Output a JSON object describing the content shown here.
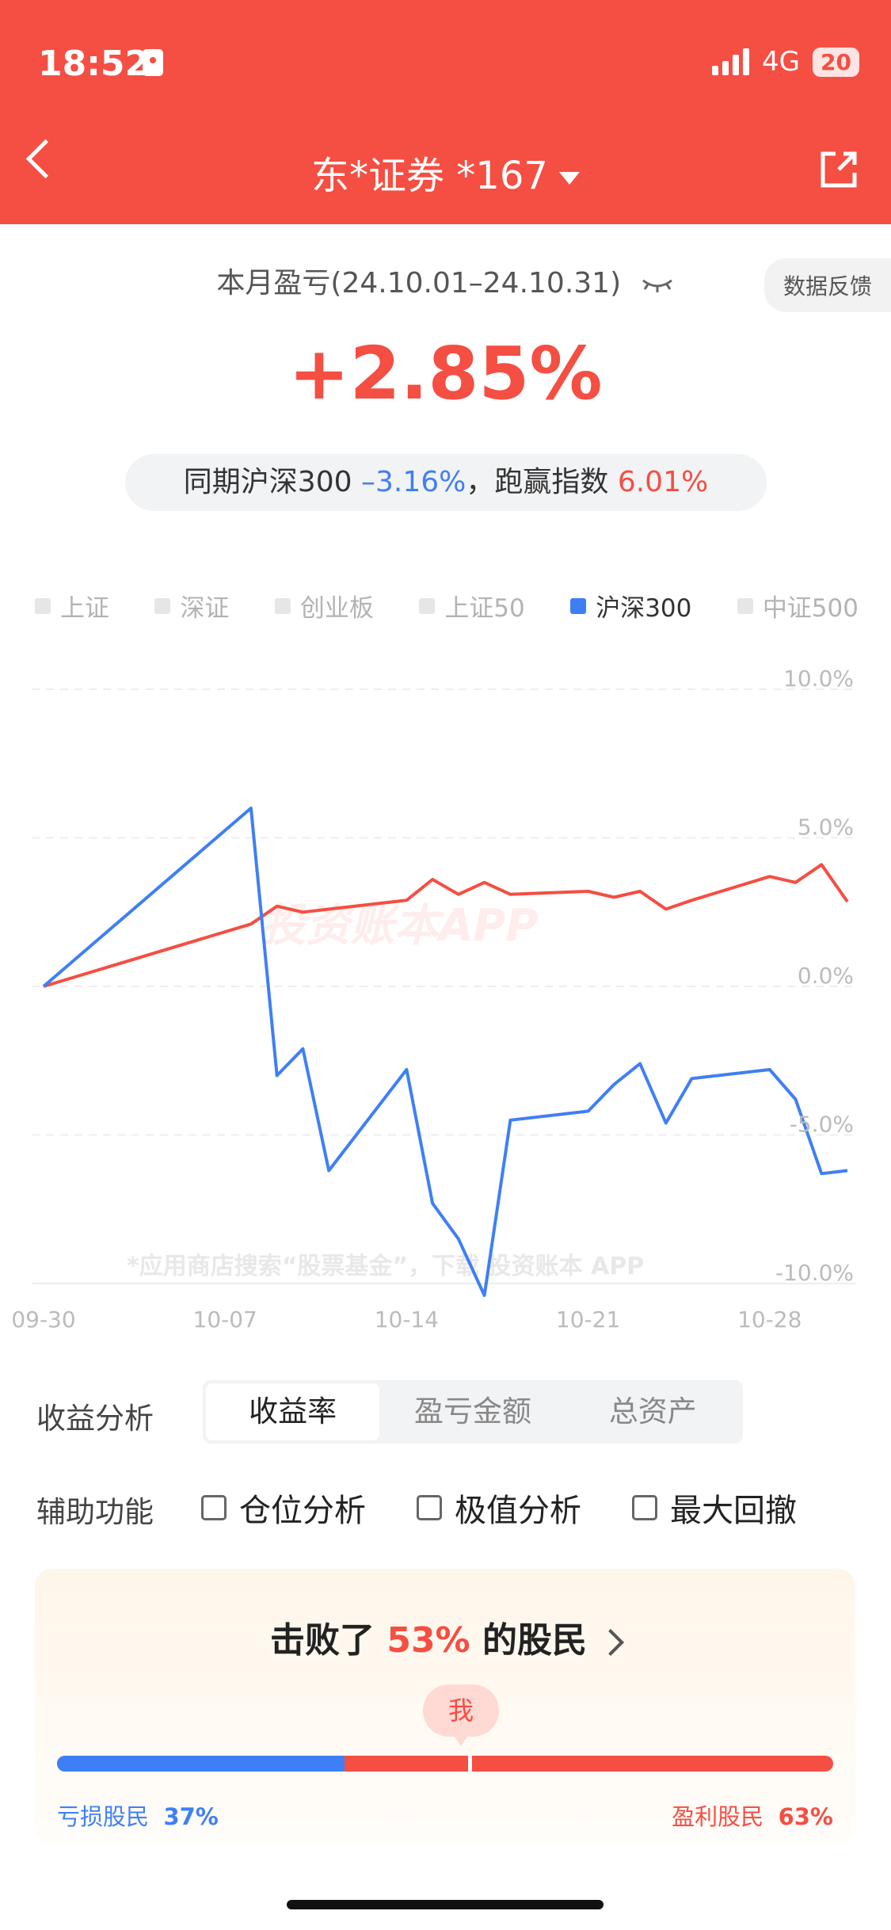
{
  "status": {
    "time": "18:52",
    "network": "4G",
    "battery": "20"
  },
  "header": {
    "title": "东*证券 *167"
  },
  "summary": {
    "period": "本月盈亏(24.10.01–24.10.31)",
    "feedback": "数据反馈",
    "return": "+2.85%",
    "compare_prefix": "同期沪深300",
    "index_return": "–3.16%",
    "compare_mid": "，跑赢指数",
    "outperform": "6.01%"
  },
  "legend": [
    {
      "label": "上证",
      "active": false
    },
    {
      "label": "深证",
      "active": false
    },
    {
      "label": "创业板",
      "active": false
    },
    {
      "label": "上证50",
      "active": false
    },
    {
      "label": "沪深300",
      "active": true
    },
    {
      "label": "中证500",
      "active": false
    }
  ],
  "colors": {
    "account": "#f54e42",
    "index": "#3f7ff5",
    "brand": "#f54e42"
  },
  "chart_data": {
    "type": "line",
    "x": [
      "09-30",
      "10-08",
      "10-09",
      "10-10",
      "10-11",
      "10-14",
      "10-15",
      "10-16",
      "10-17",
      "10-18",
      "10-21",
      "10-22",
      "10-23",
      "10-24",
      "10-25",
      "10-28",
      "10-29",
      "10-30",
      "10-31"
    ],
    "xticks": [
      "09-30",
      "10-07",
      "10-14",
      "10-21",
      "10-28"
    ],
    "yticks": [
      "10.0%",
      "5.0%",
      "0.0%",
      "-5.0%",
      "-10.0%"
    ],
    "ylim": [
      -10,
      10
    ],
    "series": [
      {
        "name": "account",
        "values": [
          0,
          2.1,
          2.7,
          2.5,
          2.6,
          2.9,
          3.6,
          3.1,
          3.5,
          3.1,
          3.2,
          3.0,
          3.2,
          2.6,
          2.9,
          3.7,
          3.5,
          4.1,
          2.85
        ]
      },
      {
        "name": "沪深300",
        "values": [
          0,
          6.0,
          -3.0,
          -2.1,
          -6.2,
          -2.8,
          -7.3,
          -8.5,
          -10.4,
          -4.5,
          -4.2,
          -3.3,
          -2.6,
          -4.6,
          -3.1,
          -2.8,
          -3.8,
          -6.3,
          -6.2
        ]
      }
    ],
    "watermark": "投资账本APP",
    "note": "*应用商店搜索“股票基金”，下载 投资账本 APP"
  },
  "analysis": {
    "label": "收益分析",
    "tabs": [
      "收益率",
      "盈亏金额",
      "总资产"
    ],
    "aux_label": "辅助功能",
    "aux": [
      "仓位分析",
      "极值分析",
      "最大回撤"
    ]
  },
  "beat": {
    "prefix": "击败了 ",
    "pct": "53%",
    "suffix": " 的股民",
    "me": "我",
    "loss_label": "亏损股民",
    "loss_pct": "37%",
    "profit_label": "盈利股民",
    "profit_pct": "63%",
    "loss_share": 0.37,
    "me_position": 0.53
  }
}
